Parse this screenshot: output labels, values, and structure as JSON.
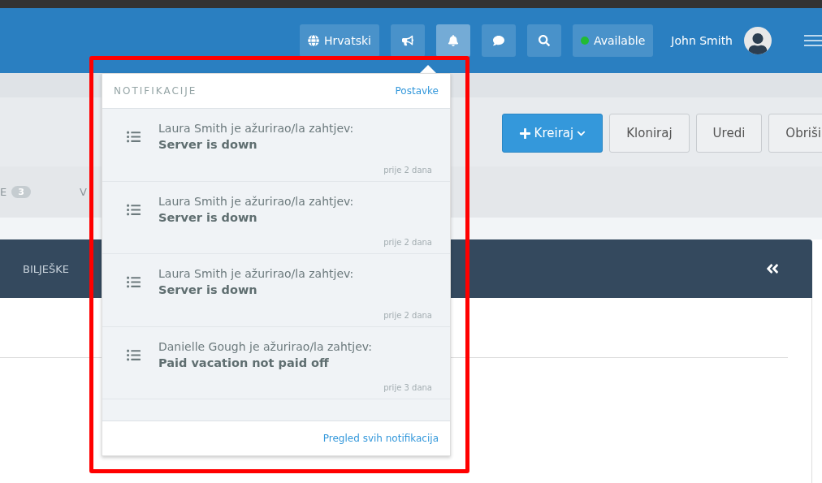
{
  "header": {
    "language": "Hrvatski",
    "notifications_selected": true,
    "status": {
      "label": "Available",
      "color": "#22bb33"
    },
    "user": "John Smith"
  },
  "toolbar": {
    "buttons": [
      {
        "label": "Kreiraj",
        "kind": "primary"
      },
      {
        "label": "Kloniraj",
        "kind": "default"
      },
      {
        "label": "Uredi",
        "kind": "default"
      },
      {
        "label": "Obriši",
        "kind": "default"
      }
    ]
  },
  "tabs": [
    {
      "label": "E",
      "count": "3"
    },
    {
      "label": "V"
    }
  ],
  "panel": {
    "title": "BILJEŠKE"
  },
  "notifications": {
    "title": "NOTIFIKACIJE",
    "settings_link": "Postavke",
    "items": [
      {
        "text": "Laura Smith je ažurirao/la zahtjev:",
        "subject": "Server is down",
        "time": "prije 2 dana"
      },
      {
        "text": "Laura Smith je ažurirao/la zahtjev:",
        "subject": "Server is down",
        "time": "prije 2 dana"
      },
      {
        "text": "Laura Smith je ažurirao/la zahtjev:",
        "subject": "Server is down",
        "time": "prije 2 dana"
      },
      {
        "text": "Danielle Gough je ažurirao/la zahtjev:",
        "subject": "Paid vacation not paid off",
        "time": "prije 3 dana"
      }
    ],
    "footer_link": "Pregled svih notifikacija"
  }
}
